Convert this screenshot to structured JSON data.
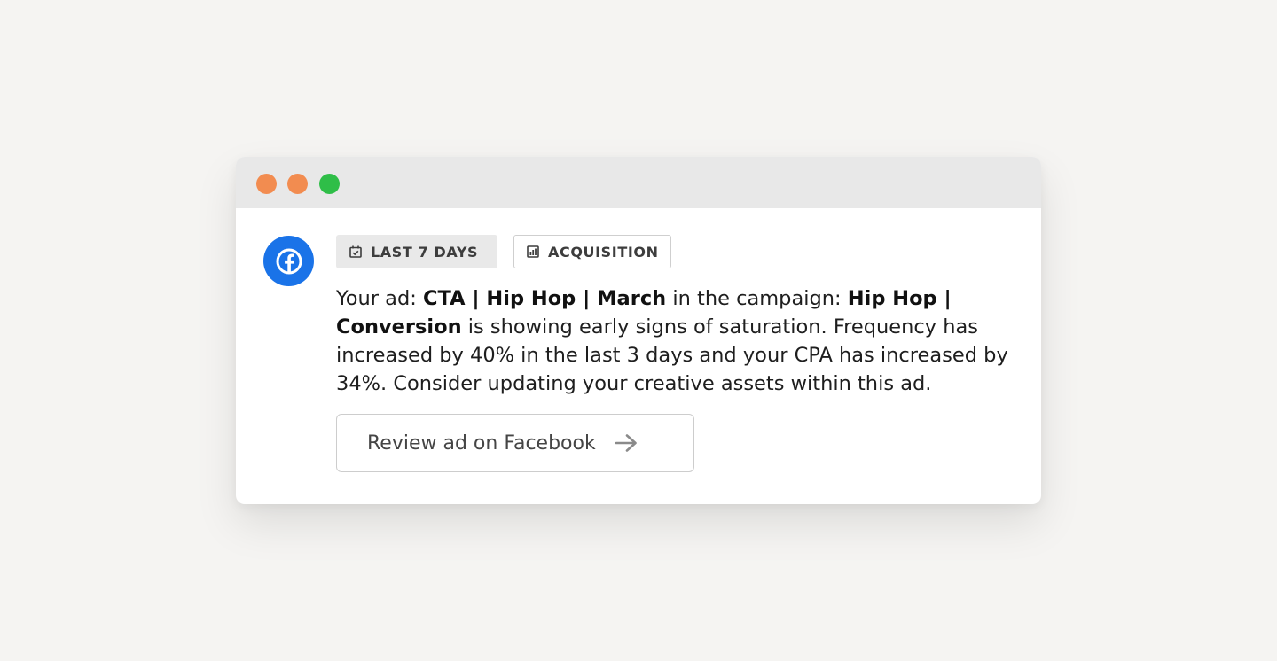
{
  "colors": {
    "dot_1": "#f28c50",
    "dot_2": "#f28c50",
    "dot_3": "#2fbe48",
    "facebook_blue": "#1a73e8"
  },
  "icons": {
    "window_dot_1": "window-control-dot-icon",
    "window_dot_2": "window-control-dot-icon",
    "window_dot_3": "window-control-dot-icon",
    "source_logo": "facebook-icon",
    "tag_1": "calendar-check-icon",
    "tag_2": "chart-bar-icon",
    "button": "arrow-right-icon"
  },
  "tags": [
    {
      "label": "LAST 7 DAYS"
    },
    {
      "label": "ACQUISITION"
    }
  ],
  "message": {
    "p1": "Your ad: ",
    "ad_name": "CTA | Hip Hop | March",
    "p2": " in the campaign: ",
    "campaign_name": "Hip Hop | Conversion",
    "p3": " is showing early signs of saturation. Frequency has increased by 40% in the last 3 days and your CPA has increased by 34%. Consider updating your creative assets within this ad."
  },
  "button": {
    "label": "Review ad on Facebook"
  }
}
